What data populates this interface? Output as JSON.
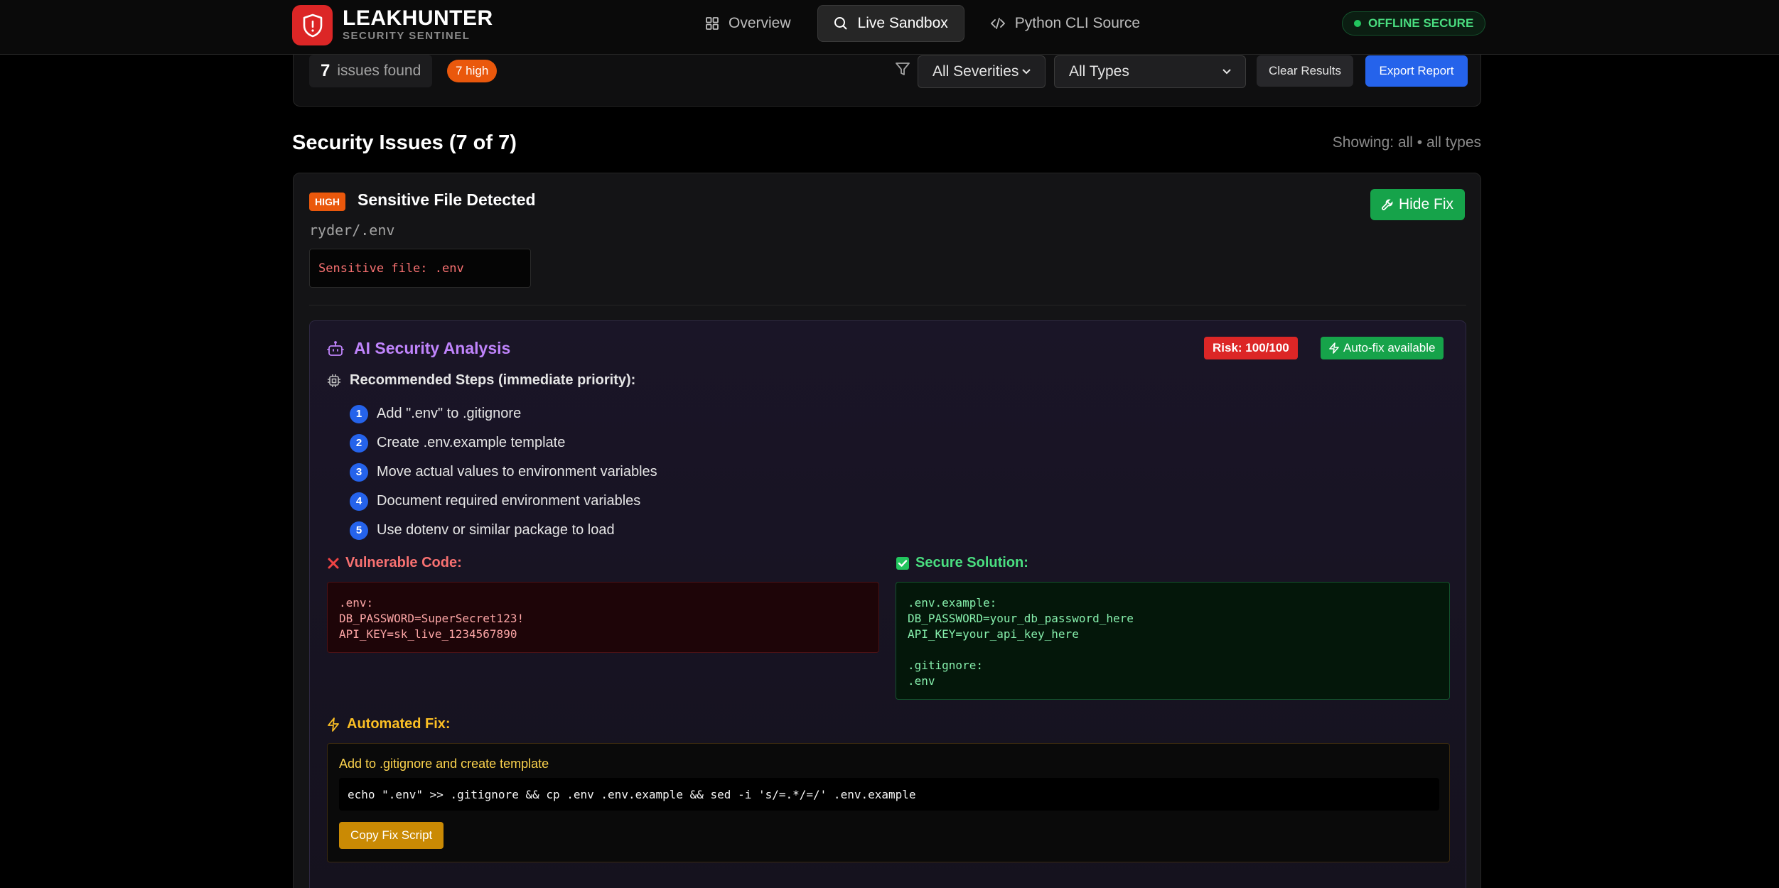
{
  "header": {
    "brand_name": "LEAKHUNTER",
    "brand_subtitle": "SECURITY SENTINEL",
    "nav": [
      {
        "label": "Overview",
        "icon": "grid-icon"
      },
      {
        "label": "Live Sandbox",
        "icon": "search-icon",
        "active": true
      },
      {
        "label": "Python CLI Source",
        "icon": "code-icon"
      }
    ],
    "status": "OFFLINE SECURE"
  },
  "filters": {
    "issue_count": "7",
    "issue_count_label": "issues found",
    "high_count": "7 high",
    "severity_value": "All Severities",
    "type_value": "All Types",
    "clear_label": "Clear Results",
    "export_label": "Export Report"
  },
  "section": {
    "title": "Security Issues (7 of 7)",
    "showing": "Showing: all • all types"
  },
  "issue": {
    "severity": "HIGH",
    "title": "Sensitive File Detected",
    "path": "ryder/.env",
    "message": "Sensitive file: .env",
    "hide_fix_label": "Hide Fix",
    "ai": {
      "title": "AI Security Analysis",
      "risk": "Risk: 100/100",
      "autofix": "Auto-fix available",
      "steps_title": "Recommended Steps (immediate priority):",
      "steps": [
        {
          "num": "1",
          "text": "Add \".env\" to .gitignore"
        },
        {
          "num": "2",
          "text": "Create .env.example template"
        },
        {
          "num": "3",
          "text": "Move actual values to environment variables"
        },
        {
          "num": "4",
          "text": "Document required environment variables"
        },
        {
          "num": "5",
          "text": "Use dotenv or similar package to load"
        }
      ],
      "vulnerable_title": "Vulnerable Code:",
      "vulnerable_code": ".env:\nDB_PASSWORD=SuperSecret123!\nAPI_KEY=sk_live_1234567890",
      "secure_title": "Secure Solution:",
      "secure_code": ".env.example:\nDB_PASSWORD=your_db_password_here\nAPI_KEY=your_api_key_here\n\n.gitignore:\n.env",
      "auto_title": "Automated Fix:",
      "auto_desc": "Add to .gitignore and create template",
      "auto_cmd": "echo \".env\" >> .gitignore && cp .env .env.example && sed -i 's/=.*/=/' .env.example",
      "copy_label": "Copy Fix Script"
    }
  },
  "colors": {
    "brand_red": "#dc2626",
    "high_orange": "#ea580c",
    "accent_blue": "#2563eb",
    "success_green": "#16a34a",
    "ai_purple": "#c084fc",
    "auto_yellow": "#ca8a04"
  }
}
